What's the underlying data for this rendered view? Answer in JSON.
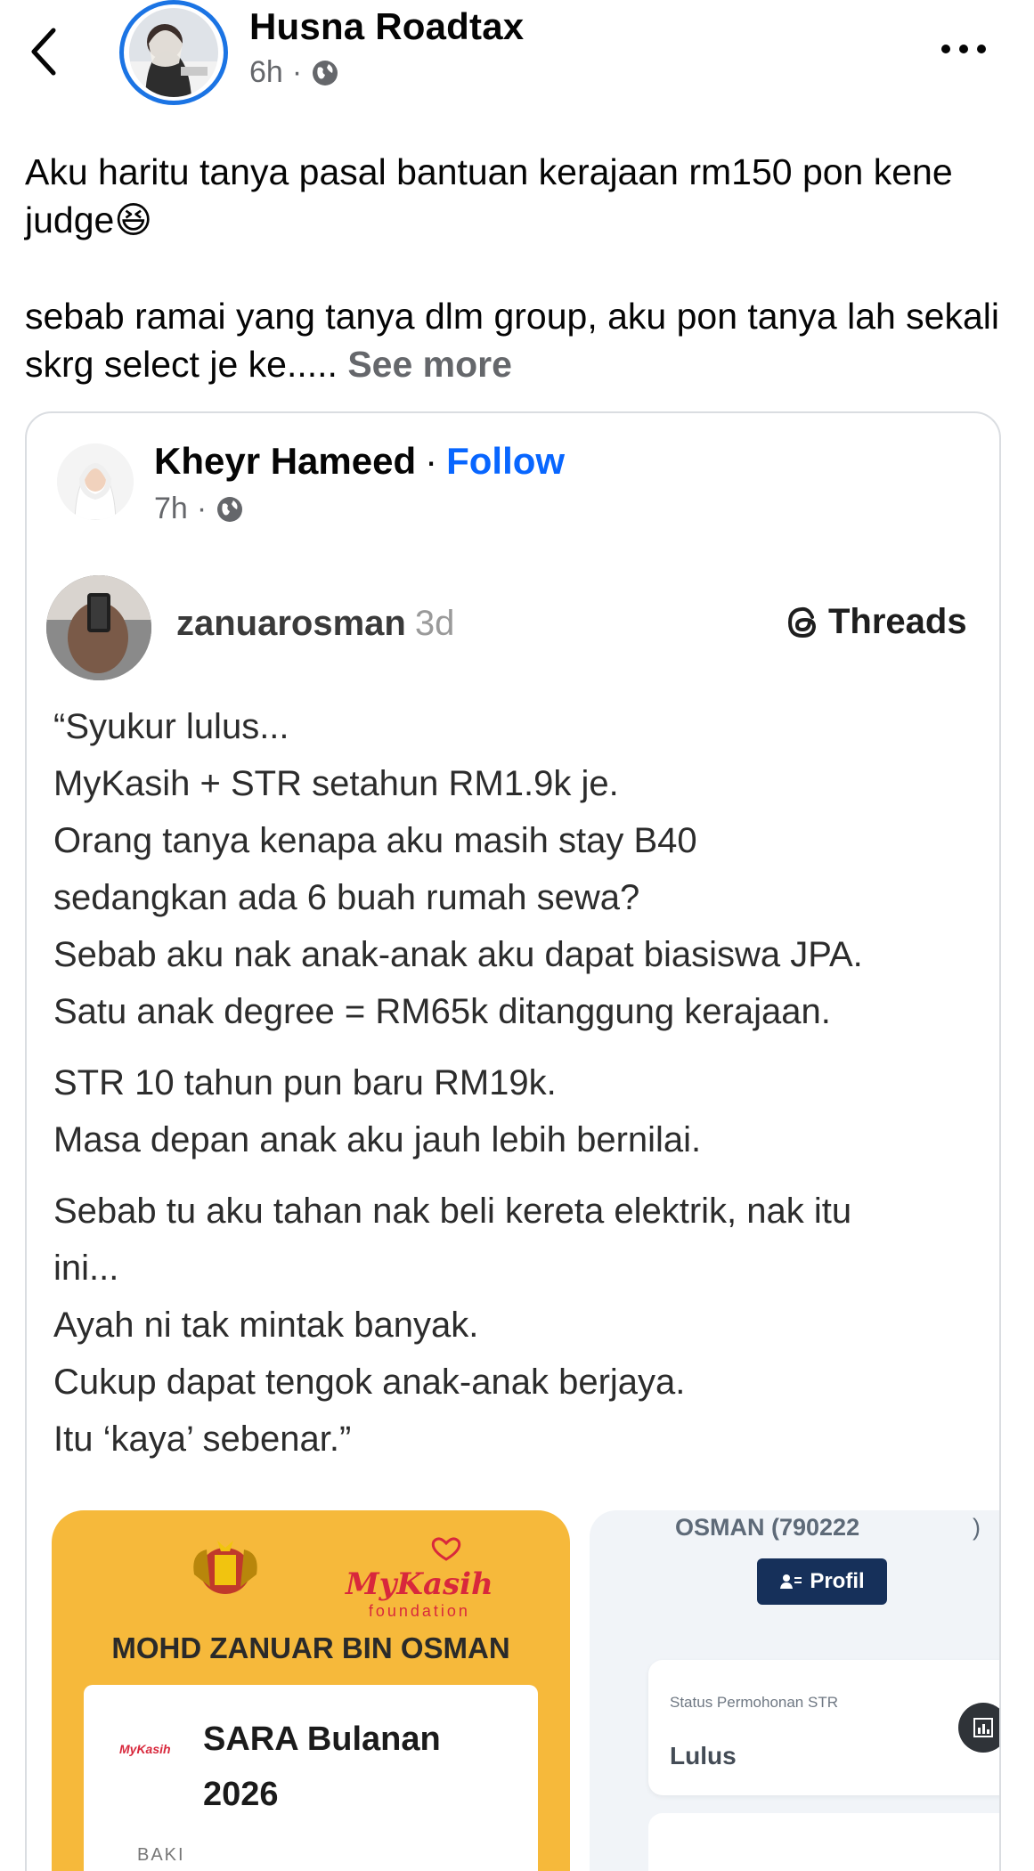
{
  "header": {
    "poster_name": "Husna Roadtax",
    "time": "6h",
    "separator": "·",
    "privacy_icon": "globe-icon",
    "back_icon": "chevron-left-icon",
    "more_icon": "more-horizontal-icon"
  },
  "post": {
    "line1": "Aku haritu tanya pasal bantuan kerajaan rm150 pon kene judge",
    "emoji": "😆",
    "line2": "sebab ramai yang tanya dlm group, aku pon tanya lah sekali skrg select je ke.....",
    "see_more": "See more"
  },
  "shared": {
    "name": "Kheyr Hameed",
    "separator": "·",
    "follow": "Follow",
    "time": "7h",
    "privacy_icon": "globe-icon"
  },
  "threads": {
    "username": "zanuarosman",
    "age": "3d",
    "brand": "Threads",
    "para1": [
      "“Syukur lulus...",
      "MyKasih + STR setahun RM1.9k je.",
      "Orang tanya kenapa aku masih stay B40",
      "sedangkan ada 6 buah rumah sewa?",
      "Sebab aku nak anak-anak aku dapat biasiswa JPA.",
      "Satu anak degree = RM65k ditanggung kerajaan."
    ],
    "para2": [
      "STR 10 tahun pun baru RM19k.",
      "Masa depan anak aku jauh lebih bernilai."
    ],
    "para3": [
      "Sebab tu aku tahan nak beli kereta elektrik, nak itu",
      "ini...",
      "Ayah ni tak mintak banyak.",
      "Cukup dapat tengok anak-anak berjaya.",
      "Itu ‘kaya’ sebenar.”"
    ]
  },
  "image_left": {
    "brand": "MyKasih",
    "brand_sub": "foundation",
    "holder": "MOHD ZANUAR BIN OSMAN",
    "card_logo": "MyKasih",
    "card_title_1": "SARA Bulanan",
    "card_title_2": "2026",
    "baki": "BAKI"
  },
  "image_right": {
    "name": "OSMAN (790222",
    "paren": ")",
    "profil": "Profil",
    "status_label": "Status Permohonan STR",
    "status_value": "Lulus"
  },
  "colors": {
    "accent": "#0866ff",
    "ring": "#1b74e4",
    "mykasih_bg": "#f6b93b",
    "profil_btn": "#16305a"
  }
}
